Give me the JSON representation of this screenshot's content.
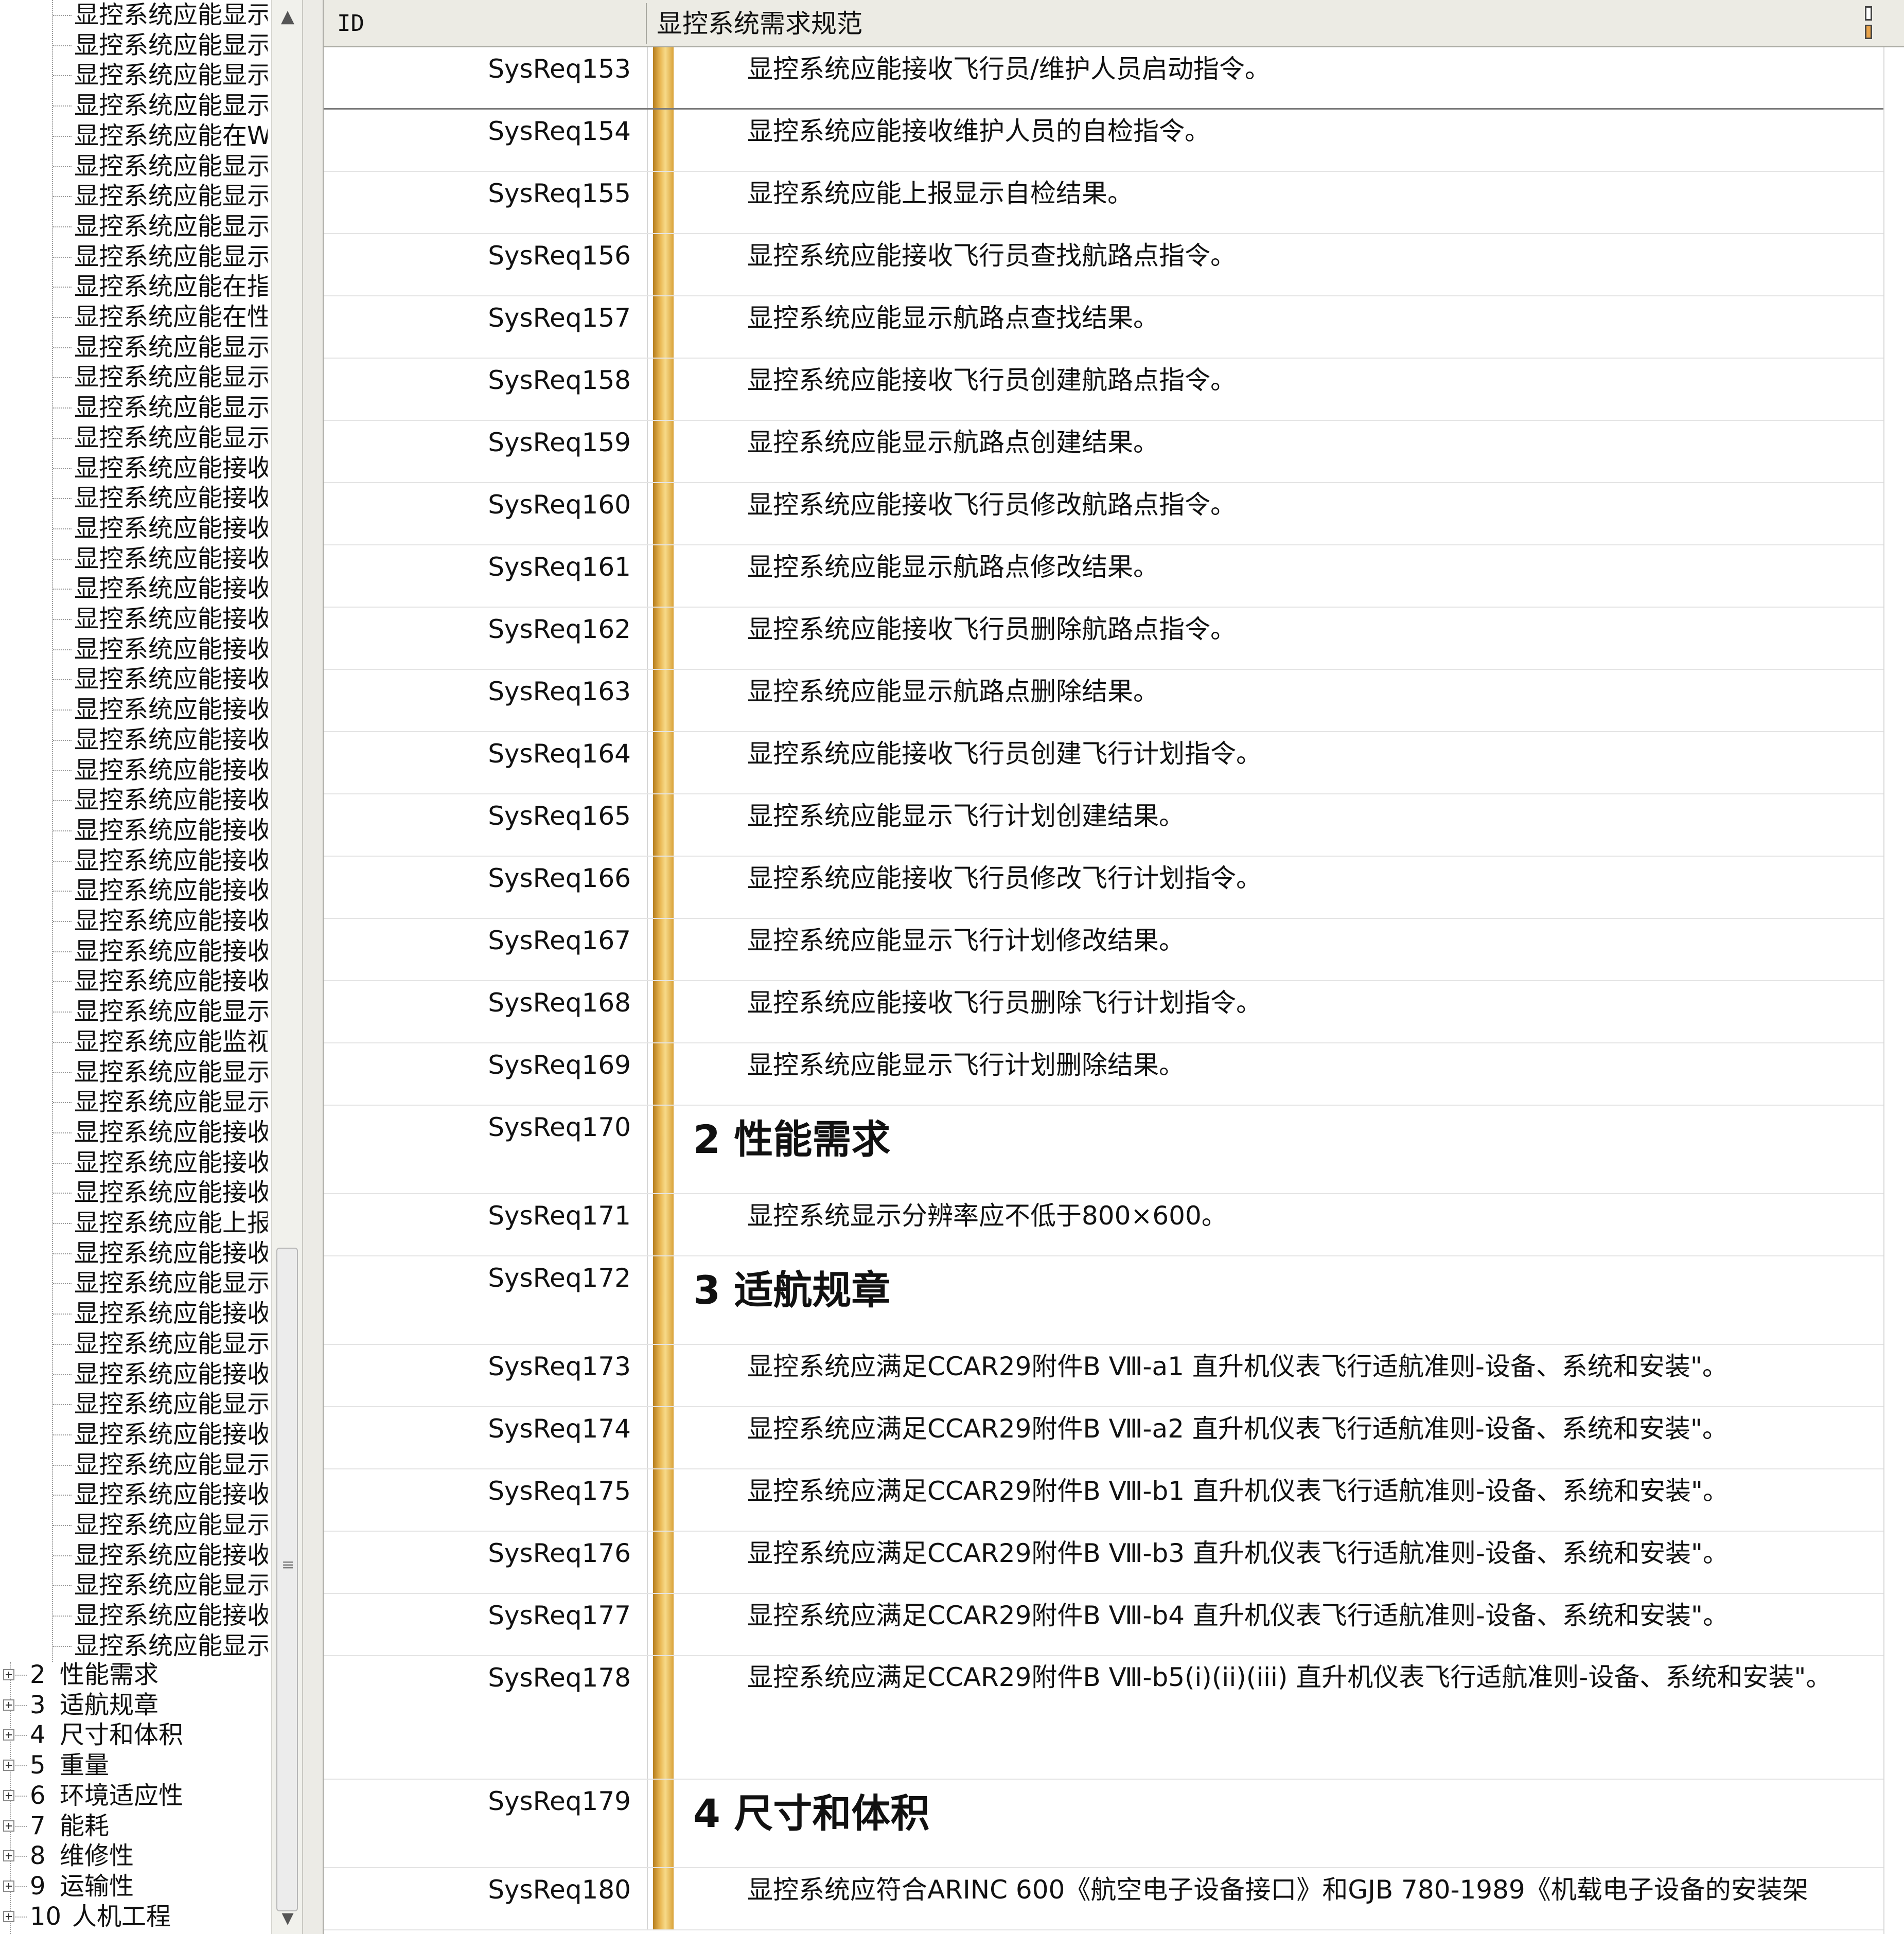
{
  "tree": {
    "leaf_items": [
      "显控系统应能显示",
      "显控系统应能显示",
      "显控系统应能显示",
      "显控系统应能显示",
      "显控系统应能在W",
      "显控系统应能显示",
      "显控系统应能显示",
      "显控系统应能显示",
      "显控系统应能显示",
      "显控系统应能在指",
      "显控系统应能在性",
      "显控系统应能显示",
      "显控系统应能显示",
      "显控系统应能显示",
      "显控系统应能显示",
      "显控系统应能接收",
      "显控系统应能接收",
      "显控系统应能接收",
      "显控系统应能接收",
      "显控系统应能接收",
      "显控系统应能接收",
      "显控系统应能接收",
      "显控系统应能接收",
      "显控系统应能接收",
      "显控系统应能接收",
      "显控系统应能接收",
      "显控系统应能接收",
      "显控系统应能接收",
      "显控系统应能接收",
      "显控系统应能接收",
      "显控系统应能接收",
      "显控系统应能接收",
      "显控系统应能接收",
      "显控系统应能显示",
      "显控系统应能监视",
      "显控系统应能显示",
      "显控系统应能显示",
      "显控系统应能接收",
      "显控系统应能接收",
      "显控系统应能接收",
      "显控系统应能上报",
      "显控系统应能接收",
      "显控系统应能显示",
      "显控系统应能接收",
      "显控系统应能显示",
      "显控系统应能接收",
      "显控系统应能显示",
      "显控系统应能接收",
      "显控系统应能显示",
      "显控系统应能接收",
      "显控系统应能显示",
      "显控系统应能接收",
      "显控系统应能显示",
      "显控系统应能接收",
      "显控系统应能显示"
    ],
    "groups": [
      {
        "num": "2",
        "label": "性能需求"
      },
      {
        "num": "3",
        "label": "适航规章"
      },
      {
        "num": "4",
        "label": "尺寸和体积"
      },
      {
        "num": "5",
        "label": "重量"
      },
      {
        "num": "6",
        "label": "环境适应性"
      },
      {
        "num": "7",
        "label": "能耗"
      },
      {
        "num": "8",
        "label": "维修性"
      },
      {
        "num": "9",
        "label": "运输性"
      },
      {
        "num": "10",
        "label": "人机工程"
      }
    ]
  },
  "grid": {
    "header_id": "ID",
    "header_spec": "显控系统需求规范",
    "rows": [
      {
        "id": "SysReq153",
        "text": "显控系统应能接收飞行员/维护人员启动指令。",
        "kind": "text"
      },
      {
        "id": "SysReq154",
        "text": "显控系统应能接收维护人员的自检指令。",
        "kind": "text"
      },
      {
        "id": "SysReq155",
        "text": "显控系统应能上报显示自检结果。",
        "kind": "text"
      },
      {
        "id": "SysReq156",
        "text": "显控系统应能接收飞行员查找航路点指令。",
        "kind": "text"
      },
      {
        "id": "SysReq157",
        "text": "显控系统应能显示航路点查找结果。",
        "kind": "text"
      },
      {
        "id": "SysReq158",
        "text": "显控系统应能接收飞行员创建航路点指令。",
        "kind": "text"
      },
      {
        "id": "SysReq159",
        "text": "显控系统应能显示航路点创建结果。",
        "kind": "text"
      },
      {
        "id": "SysReq160",
        "text": "显控系统应能接收飞行员修改航路点指令。",
        "kind": "text"
      },
      {
        "id": "SysReq161",
        "text": "显控系统应能显示航路点修改结果。",
        "kind": "text"
      },
      {
        "id": "SysReq162",
        "text": "显控系统应能接收飞行员删除航路点指令。",
        "kind": "text"
      },
      {
        "id": "SysReq163",
        "text": "显控系统应能显示航路点删除结果。",
        "kind": "text"
      },
      {
        "id": "SysReq164",
        "text": "显控系统应能接收飞行员创建飞行计划指令。",
        "kind": "text"
      },
      {
        "id": "SysReq165",
        "text": "显控系统应能显示飞行计划创建结果。",
        "kind": "text"
      },
      {
        "id": "SysReq166",
        "text": "显控系统应能接收飞行员修改飞行计划指令。",
        "kind": "text"
      },
      {
        "id": "SysReq167",
        "text": "显控系统应能显示飞行计划修改结果。",
        "kind": "text"
      },
      {
        "id": "SysReq168",
        "text": "显控系统应能接收飞行员删除飞行计划指令。",
        "kind": "text"
      },
      {
        "id": "SysReq169",
        "text": "显控系统应能显示飞行计划删除结果。",
        "kind": "text"
      },
      {
        "id": "SysReq170",
        "text": "2 性能需求",
        "kind": "heading"
      },
      {
        "id": "SysReq171",
        "text": "显控系统显示分辨率应不低于800×600。",
        "kind": "text"
      },
      {
        "id": "SysReq172",
        "text": "3 适航规章",
        "kind": "heading"
      },
      {
        "id": "SysReq173",
        "text": "显控系统应满足CCAR29附件B Ⅷ-a1 直升机仪表飞行适航准则-设备、系统和安装\"。",
        "kind": "text"
      },
      {
        "id": "SysReq174",
        "text": "显控系统应满足CCAR29附件B Ⅷ-a2 直升机仪表飞行适航准则-设备、系统和安装\"。",
        "kind": "text"
      },
      {
        "id": "SysReq175",
        "text": "显控系统应满足CCAR29附件B Ⅷ-b1 直升机仪表飞行适航准则-设备、系统和安装\"。",
        "kind": "text"
      },
      {
        "id": "SysReq176",
        "text": "显控系统应满足CCAR29附件B Ⅷ-b3 直升机仪表飞行适航准则-设备、系统和安装\"。",
        "kind": "text"
      },
      {
        "id": "SysReq177",
        "text": "显控系统应满足CCAR29附件B Ⅷ-b4 直升机仪表飞行适航准则-设备、系统和安装\"。",
        "kind": "text"
      },
      {
        "id": "SysReq178",
        "text": "显控系统应满足CCAR29附件B Ⅷ-b5(i)(ii)(iii) 直升机仪表飞行适航准则-设备、系统和安装\"。",
        "kind": "wrap"
      },
      {
        "id": "SysReq179",
        "text": "4 尺寸和体积",
        "kind": "heading"
      },
      {
        "id": "SysReq180",
        "text": "显控系统应符合ARINC 600《航空电子设备接口》和GJB 780-1989《机载电子设备的安装架",
        "kind": "text"
      }
    ]
  },
  "icons": {
    "expander": "plus-box-icon",
    "scroll_up": "scroll-up-arrow-icon",
    "scroll_down": "scroll-down-arrow-icon",
    "column_chooser": "column-chooser-icon"
  },
  "colors": {
    "gold_bar": "#e9b753",
    "header_bg": "#ecebe4"
  }
}
